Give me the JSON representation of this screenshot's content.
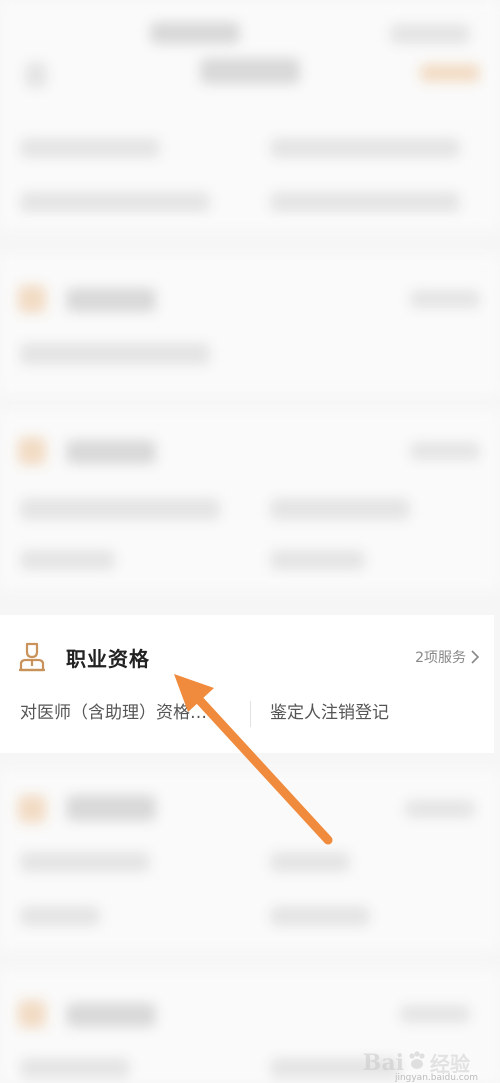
{
  "card": {
    "title": "职业资格",
    "service_count": "2项服务",
    "icon": "person-badge-icon",
    "chevron_icon": "chevron-right-icon",
    "services": [
      "对医师（含助理）资格…",
      "鉴定人注销登记"
    ]
  },
  "watermark": {
    "brand": "Bai",
    "sub": "经验",
    "url": "jingyan.baidu.com"
  },
  "colors": {
    "accent": "#f08a3c",
    "icon": "#c8925a",
    "title": "#222222",
    "muted": "#888888"
  }
}
